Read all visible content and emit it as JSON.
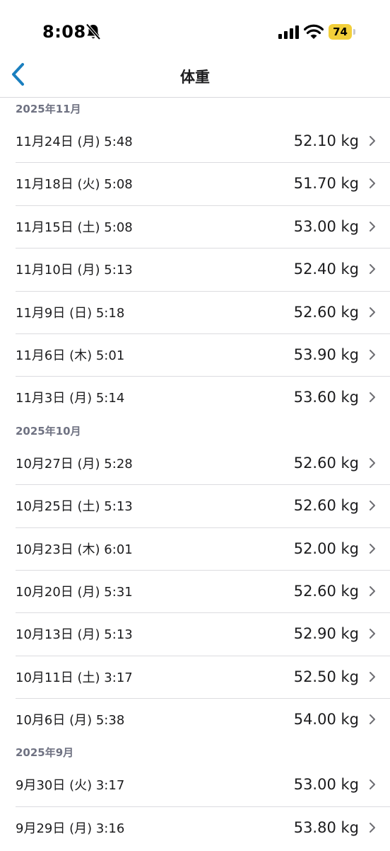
{
  "status_bar": {
    "time": "8:08",
    "battery_level": "74",
    "battery_color": "#f2cf3a",
    "icons": [
      "bell-slash-icon",
      "cellular-signal-icon",
      "wifi-icon",
      "battery-icon"
    ]
  },
  "nav": {
    "title": "体重",
    "back_icon": "chevron-left-icon",
    "accent_color": "#1a7fbf"
  },
  "sections": [
    {
      "header": "2025年11月",
      "entries": [
        {
          "date": "11月24日 (月) 5:48",
          "weight": "52.10 kg"
        },
        {
          "date": "11月18日 (火) 5:08",
          "weight": "51.70 kg"
        },
        {
          "date": "11月15日 (土) 5:08",
          "weight": "53.00 kg"
        },
        {
          "date": "11月10日 (月) 5:13",
          "weight": "52.40 kg"
        },
        {
          "date": "11月9日 (日) 5:18",
          "weight": "52.60 kg"
        },
        {
          "date": "11月6日 (木) 5:01",
          "weight": "53.90 kg"
        },
        {
          "date": "11月3日 (月) 5:14",
          "weight": "53.60 kg"
        }
      ]
    },
    {
      "header": "2025年10月",
      "entries": [
        {
          "date": "10月27日 (月) 5:28",
          "weight": "52.60 kg"
        },
        {
          "date": "10月25日 (土) 5:13",
          "weight": "52.60 kg"
        },
        {
          "date": "10月23日 (木) 6:01",
          "weight": "52.00 kg"
        },
        {
          "date": "10月20日 (月) 5:31",
          "weight": "52.60 kg"
        },
        {
          "date": "10月13日 (月) 5:13",
          "weight": "52.90 kg"
        },
        {
          "date": "10月11日 (土) 3:17",
          "weight": "52.50 kg"
        },
        {
          "date": "10月6日 (月) 5:38",
          "weight": "54.00 kg"
        }
      ]
    },
    {
      "header": "2025年9月",
      "entries": [
        {
          "date": "9月30日 (火) 3:17",
          "weight": "53.00 kg"
        },
        {
          "date": "9月29日 (月) 3:16",
          "weight": "53.80 kg"
        }
      ]
    }
  ]
}
